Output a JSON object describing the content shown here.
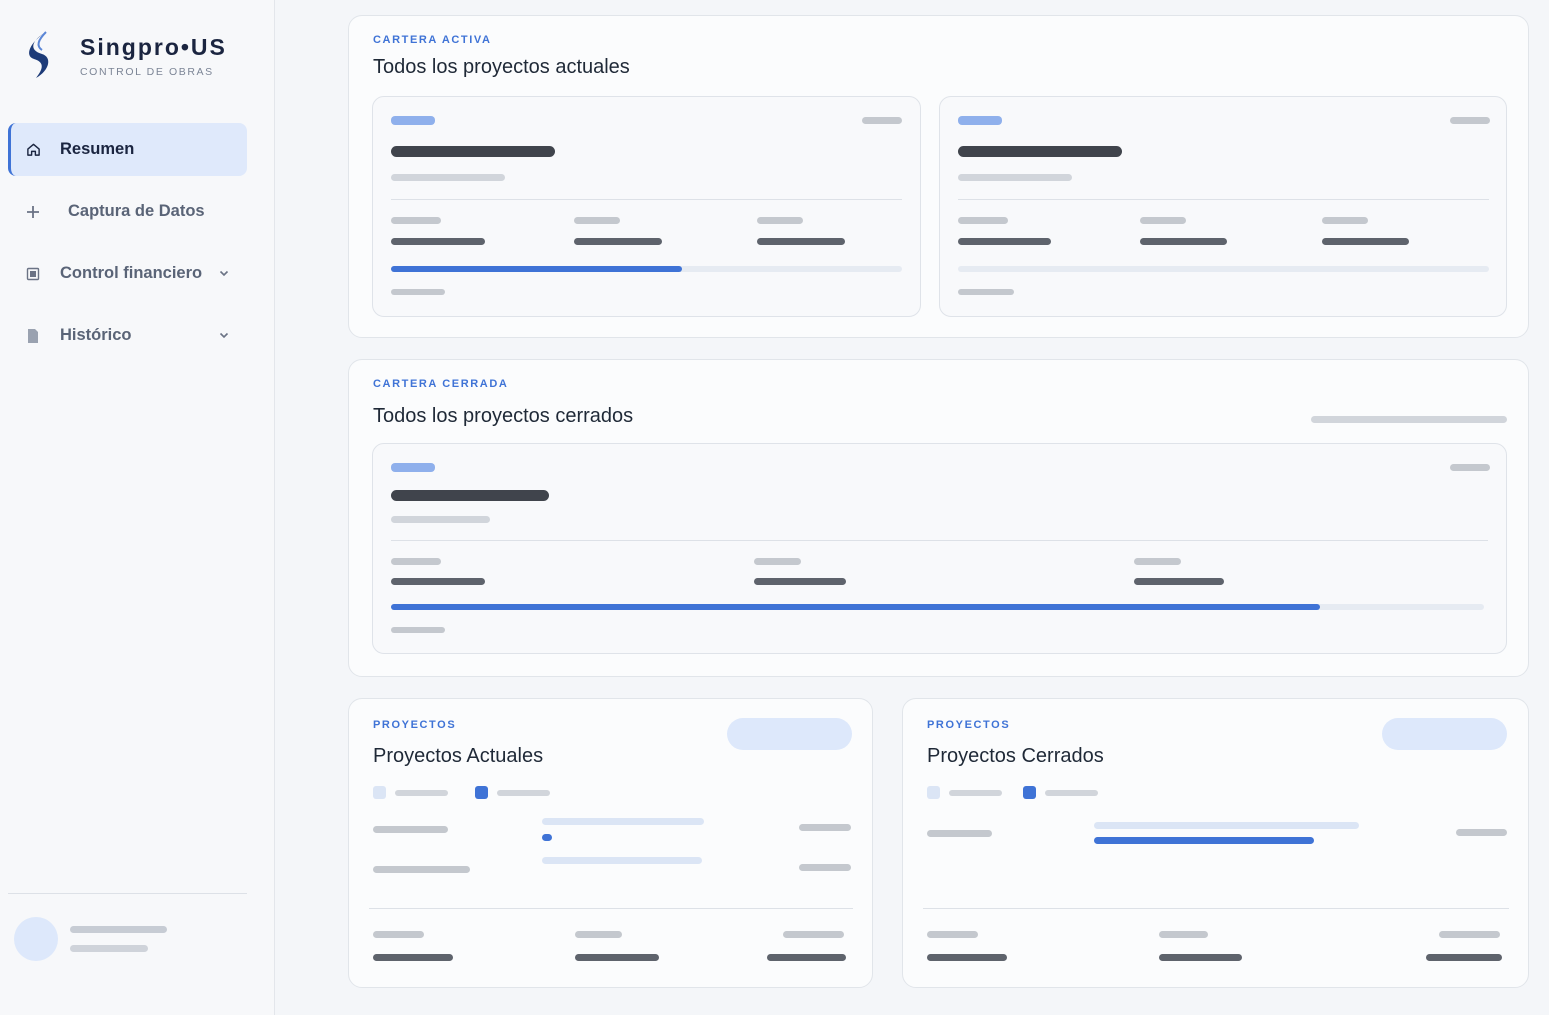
{
  "brand": {
    "name": "Singpro•US",
    "subtitle": "CONTROL DE OBRAS"
  },
  "sidebar": {
    "items": [
      {
        "label": "Resumen",
        "icon": "home-icon",
        "active": true
      },
      {
        "label": "Captura de Datos",
        "icon": "plus-icon"
      },
      {
        "label": "Control financiero",
        "icon": "wallet-icon",
        "expandable": true
      },
      {
        "label": "Histórico",
        "icon": "document-icon",
        "expandable": true
      }
    ]
  },
  "active_portfolio": {
    "eyebrow": "CARTERA ACTIVA",
    "title": "Todos los proyectos actuales",
    "projects": [
      {
        "progress": 0.57
      },
      {
        "progress": 0
      }
    ]
  },
  "closed_portfolio": {
    "eyebrow": "CARTERA CERRADA",
    "title": "Todos los proyectos cerrados",
    "projects": [
      {
        "progress": 0.85
      }
    ]
  },
  "current_projects": {
    "eyebrow": "PROYECTOS",
    "title": "Proyectos Actuales"
  },
  "closed_projects": {
    "eyebrow": "PROYECTOS",
    "title": "Proyectos Cerrados"
  },
  "colors": {
    "accent": "#3f73d6",
    "accent_light": "#dde8fb",
    "sidebar_bg": "#f7f8fa"
  }
}
